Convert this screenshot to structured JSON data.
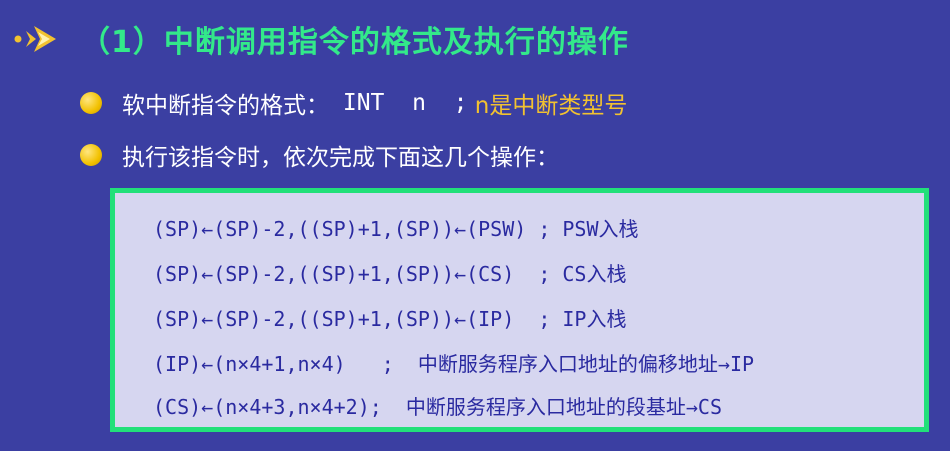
{
  "title": "（1）中断调用指令的格式及执行的操作",
  "bullets": [
    {
      "label": "软中断指令的格式：",
      "code": " INT  n  ;",
      "note": " n是中断类型号"
    },
    {
      "label": "执行该指令时，依次完成下面这几个操作："
    }
  ],
  "operations": [
    "(SP)←(SP)-2,((SP)+1,(SP))←(PSW) ; PSW入栈",
    "(SP)←(SP)-2,((SP)+1,(SP))←(CS)  ; CS入栈",
    "(SP)←(SP)-2,((SP)+1,(SP))←(IP)  ; IP入栈",
    "(IP)←(n×4+1,n×4)   ;  中断服务程序入口地址的偏移地址→IP",
    "(CS)←(n×4+3,n×4+2);  中断服务程序入口地址的段基址→CS"
  ],
  "colors": {
    "background": "#3b3fa2",
    "title": "#33e98a",
    "highlight": "#f2c230",
    "box_border": "#22e07a",
    "box_text": "#2a2aa0"
  }
}
